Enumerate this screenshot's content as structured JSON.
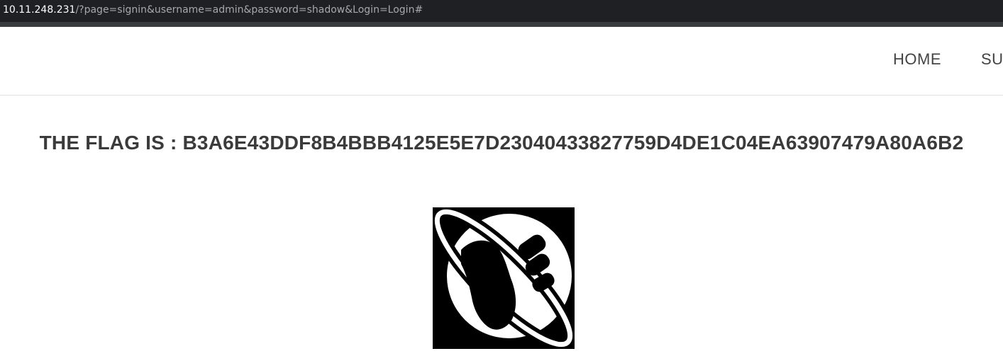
{
  "browser": {
    "url_host": "10.11.248.231",
    "url_rest": "/?page=signin&username=admin&password=shadow&Login=Login#"
  },
  "nav": {
    "items": [
      {
        "label": "HOME"
      },
      {
        "label": "SU"
      }
    ]
  },
  "main": {
    "flag_text": "THE FLAG IS : B3A6E43DDF8B4BBB4125E5E7D23040433827759D4DE1C04EA63907479A80A6B2",
    "logo_icon": "thumbs-up-planet-icon"
  },
  "colors": {
    "url_bar_bg": "#1f2023",
    "text_dark": "#3b3b3b",
    "logo_bg": "#000000"
  }
}
